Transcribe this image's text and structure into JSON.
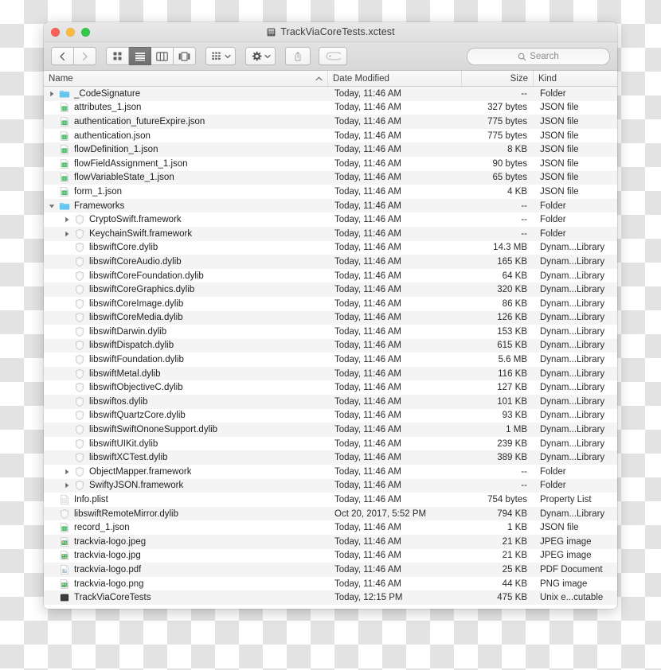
{
  "window": {
    "title": "TrackViaCoreTests.xctest",
    "title_icon": "package-bundle-icon",
    "traffic_lights": {
      "close_label": "Close",
      "minimize_label": "Minimize",
      "maximize_label": "Maximize",
      "close_color": "#fc6058",
      "minimize_color": "#fdbc40",
      "maximize_color": "#34c84a"
    }
  },
  "toolbar": {
    "back_icon": "chevron-left-icon",
    "forward_icon": "chevron-right-icon",
    "view_icon_label": "Icon View",
    "view_list_label": "List View",
    "view_column_label": "Column View",
    "view_gallery_label": "Gallery View",
    "active_view": "list",
    "arrange_icon": "grid-arrange-icon",
    "action_icon": "gear-icon",
    "share_icon": "share-upload-icon",
    "tag_icon": "tag-icon",
    "dropdown_icon": "chevron-down-icon"
  },
  "search": {
    "icon": "search-icon",
    "placeholder": "Search",
    "value": ""
  },
  "columns": {
    "name": "Name",
    "date_modified": "Date Modified",
    "size": "Size",
    "kind": "Kind",
    "sort_by": "Name",
    "sort_direction": "ascending",
    "sort_icon": "chevron-up-icon"
  },
  "files": [
    {
      "name": "_CodeSignature",
      "date": "Today, 11:46 AM",
      "size": "--",
      "kind": "Folder",
      "icon": "folder-icon",
      "indent": 0,
      "disclosure": "collapsed"
    },
    {
      "name": "attributes_1.json",
      "date": "Today, 11:46 AM",
      "size": "327 bytes",
      "kind": "JSON file",
      "icon": "json-file-icon",
      "indent": 0,
      "disclosure": "none"
    },
    {
      "name": "authentication_futureExpire.json",
      "date": "Today, 11:46 AM",
      "size": "775 bytes",
      "kind": "JSON file",
      "icon": "json-file-icon",
      "indent": 0,
      "disclosure": "none"
    },
    {
      "name": "authentication.json",
      "date": "Today, 11:46 AM",
      "size": "775 bytes",
      "kind": "JSON file",
      "icon": "json-file-icon",
      "indent": 0,
      "disclosure": "none"
    },
    {
      "name": "flowDefinition_1.json",
      "date": "Today, 11:46 AM",
      "size": "8 KB",
      "kind": "JSON file",
      "icon": "json-file-icon",
      "indent": 0,
      "disclosure": "none"
    },
    {
      "name": "flowFieldAssignment_1.json",
      "date": "Today, 11:46 AM",
      "size": "90 bytes",
      "kind": "JSON file",
      "icon": "json-file-icon",
      "indent": 0,
      "disclosure": "none"
    },
    {
      "name": "flowVariableState_1.json",
      "date": "Today, 11:46 AM",
      "size": "65 bytes",
      "kind": "JSON file",
      "icon": "json-file-icon",
      "indent": 0,
      "disclosure": "none"
    },
    {
      "name": "form_1.json",
      "date": "Today, 11:46 AM",
      "size": "4 KB",
      "kind": "JSON file",
      "icon": "json-file-icon",
      "indent": 0,
      "disclosure": "none"
    },
    {
      "name": "Frameworks",
      "date": "Today, 11:46 AM",
      "size": "--",
      "kind": "Folder",
      "icon": "folder-icon",
      "indent": 0,
      "disclosure": "expanded"
    },
    {
      "name": "CryptoSwift.framework",
      "date": "Today, 11:46 AM",
      "size": "--",
      "kind": "Folder",
      "icon": "framework-icon",
      "indent": 1,
      "disclosure": "collapsed"
    },
    {
      "name": "KeychainSwift.framework",
      "date": "Today, 11:46 AM",
      "size": "--",
      "kind": "Folder",
      "icon": "framework-icon",
      "indent": 1,
      "disclosure": "collapsed"
    },
    {
      "name": "libswiftCore.dylib",
      "date": "Today, 11:46 AM",
      "size": "14.3 MB",
      "kind": "Dynam...Library",
      "icon": "framework-icon",
      "indent": 1,
      "disclosure": "none"
    },
    {
      "name": "libswiftCoreAudio.dylib",
      "date": "Today, 11:46 AM",
      "size": "165 KB",
      "kind": "Dynam...Library",
      "icon": "framework-icon",
      "indent": 1,
      "disclosure": "none"
    },
    {
      "name": "libswiftCoreFoundation.dylib",
      "date": "Today, 11:46 AM",
      "size": "64 KB",
      "kind": "Dynam...Library",
      "icon": "framework-icon",
      "indent": 1,
      "disclosure": "none"
    },
    {
      "name": "libswiftCoreGraphics.dylib",
      "date": "Today, 11:46 AM",
      "size": "320 KB",
      "kind": "Dynam...Library",
      "icon": "framework-icon",
      "indent": 1,
      "disclosure": "none"
    },
    {
      "name": "libswiftCoreImage.dylib",
      "date": "Today, 11:46 AM",
      "size": "86 KB",
      "kind": "Dynam...Library",
      "icon": "framework-icon",
      "indent": 1,
      "disclosure": "none"
    },
    {
      "name": "libswiftCoreMedia.dylib",
      "date": "Today, 11:46 AM",
      "size": "126 KB",
      "kind": "Dynam...Library",
      "icon": "framework-icon",
      "indent": 1,
      "disclosure": "none"
    },
    {
      "name": "libswiftDarwin.dylib",
      "date": "Today, 11:46 AM",
      "size": "153 KB",
      "kind": "Dynam...Library",
      "icon": "framework-icon",
      "indent": 1,
      "disclosure": "none"
    },
    {
      "name": "libswiftDispatch.dylib",
      "date": "Today, 11:46 AM",
      "size": "615 KB",
      "kind": "Dynam...Library",
      "icon": "framework-icon",
      "indent": 1,
      "disclosure": "none"
    },
    {
      "name": "libswiftFoundation.dylib",
      "date": "Today, 11:46 AM",
      "size": "5.6 MB",
      "kind": "Dynam...Library",
      "icon": "framework-icon",
      "indent": 1,
      "disclosure": "none"
    },
    {
      "name": "libswiftMetal.dylib",
      "date": "Today, 11:46 AM",
      "size": "116 KB",
      "kind": "Dynam...Library",
      "icon": "framework-icon",
      "indent": 1,
      "disclosure": "none"
    },
    {
      "name": "libswiftObjectiveC.dylib",
      "date": "Today, 11:46 AM",
      "size": "127 KB",
      "kind": "Dynam...Library",
      "icon": "framework-icon",
      "indent": 1,
      "disclosure": "none"
    },
    {
      "name": "libswiftos.dylib",
      "date": "Today, 11:46 AM",
      "size": "101 KB",
      "kind": "Dynam...Library",
      "icon": "framework-icon",
      "indent": 1,
      "disclosure": "none"
    },
    {
      "name": "libswiftQuartzCore.dylib",
      "date": "Today, 11:46 AM",
      "size": "93 KB",
      "kind": "Dynam...Library",
      "icon": "framework-icon",
      "indent": 1,
      "disclosure": "none"
    },
    {
      "name": "libswiftSwiftOnoneSupport.dylib",
      "date": "Today, 11:46 AM",
      "size": "1 MB",
      "kind": "Dynam...Library",
      "icon": "framework-icon",
      "indent": 1,
      "disclosure": "none"
    },
    {
      "name": "libswiftUIKit.dylib",
      "date": "Today, 11:46 AM",
      "size": "239 KB",
      "kind": "Dynam...Library",
      "icon": "framework-icon",
      "indent": 1,
      "disclosure": "none"
    },
    {
      "name": "libswiftXCTest.dylib",
      "date": "Today, 11:46 AM",
      "size": "389 KB",
      "kind": "Dynam...Library",
      "icon": "framework-icon",
      "indent": 1,
      "disclosure": "none"
    },
    {
      "name": "ObjectMapper.framework",
      "date": "Today, 11:46 AM",
      "size": "--",
      "kind": "Folder",
      "icon": "framework-icon",
      "indent": 1,
      "disclosure": "collapsed"
    },
    {
      "name": "SwiftyJSON.framework",
      "date": "Today, 11:46 AM",
      "size": "--",
      "kind": "Folder",
      "icon": "framework-icon",
      "indent": 1,
      "disclosure": "collapsed"
    },
    {
      "name": "Info.plist",
      "date": "Today, 11:46 AM",
      "size": "754 bytes",
      "kind": "Property List",
      "icon": "plist-file-icon",
      "indent": 0,
      "disclosure": "none"
    },
    {
      "name": "libswiftRemoteMirror.dylib",
      "date": "Oct 20, 2017, 5:52 PM",
      "size": "794 KB",
      "kind": "Dynam...Library",
      "icon": "framework-icon",
      "indent": 0,
      "disclosure": "none"
    },
    {
      "name": "record_1.json",
      "date": "Today, 11:46 AM",
      "size": "1 KB",
      "kind": "JSON file",
      "icon": "json-file-icon",
      "indent": 0,
      "disclosure": "none"
    },
    {
      "name": "trackvia-logo.jpeg",
      "date": "Today, 11:46 AM",
      "size": "21 KB",
      "kind": "JPEG image",
      "icon": "image-file-icon",
      "indent": 0,
      "disclosure": "none"
    },
    {
      "name": "trackvia-logo.jpg",
      "date": "Today, 11:46 AM",
      "size": "21 KB",
      "kind": "JPEG image",
      "icon": "image-file-icon",
      "indent": 0,
      "disclosure": "none"
    },
    {
      "name": "trackvia-logo.pdf",
      "date": "Today, 11:46 AM",
      "size": "25 KB",
      "kind": "PDF Document",
      "icon": "pdf-file-icon",
      "indent": 0,
      "disclosure": "none"
    },
    {
      "name": "trackvia-logo.png",
      "date": "Today, 11:46 AM",
      "size": "44 KB",
      "kind": "PNG image",
      "icon": "image-file-icon",
      "indent": 0,
      "disclosure": "none"
    },
    {
      "name": "TrackViaCoreTests",
      "date": "Today, 12:15 PM",
      "size": "475 KB",
      "kind": "Unix e...cutable",
      "icon": "unix-executable-icon",
      "indent": 0,
      "disclosure": "none"
    }
  ]
}
